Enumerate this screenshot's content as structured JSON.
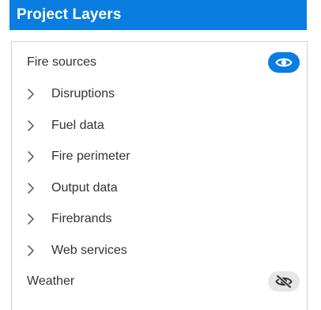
{
  "header": {
    "title": "Project Layers"
  },
  "layers": {
    "fire_sources": {
      "label": "Fire sources",
      "visible": true,
      "icon": "eye-icon"
    },
    "groups": [
      {
        "label": "Disruptions",
        "icon": "chevron-right-icon"
      },
      {
        "label": "Fuel data",
        "icon": "chevron-right-icon"
      },
      {
        "label": "Fire perimeter",
        "icon": "chevron-right-icon"
      },
      {
        "label": "Output data",
        "icon": "chevron-right-icon"
      },
      {
        "label": "Firebrands",
        "icon": "chevron-right-icon"
      },
      {
        "label": "Web services",
        "icon": "chevron-right-icon"
      }
    ],
    "weather": {
      "label": "Weather",
      "visible": false,
      "icon": "eye-off-icon"
    }
  },
  "colors": {
    "accent": "#0a7de0",
    "text": "#333333",
    "border": "#d2d2d2",
    "toggle_off_bg": "#e6e6e6"
  }
}
